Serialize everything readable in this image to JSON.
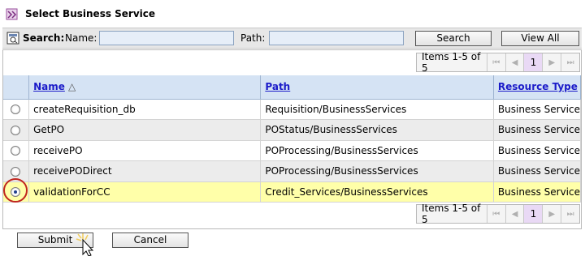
{
  "dialog": {
    "title": "Select Business Service"
  },
  "icons": {
    "title": "business-service-icon",
    "search": "search-icon"
  },
  "search": {
    "label": "Search:",
    "name_label": "Name:",
    "name_value": "",
    "path_label": "Path:",
    "path_value": "",
    "search_button": "Search",
    "view_all_button": "View All"
  },
  "pager": {
    "items_text": "Items 1-5 of 5",
    "current_page": "1",
    "first": "⏮",
    "prev": "◀",
    "next": "▶",
    "last": "⏭"
  },
  "table": {
    "columns": {
      "name": "Name",
      "path": "Path",
      "type": "Resource Type"
    },
    "sort_indicator": "△",
    "rows": [
      {
        "name": "createRequisition_db",
        "path": "Requisition/BusinessServices",
        "type": "Business Service"
      },
      {
        "name": "GetPO",
        "path": "POStatus/BusinessServices",
        "type": "Business Service"
      },
      {
        "name": "receivePO",
        "path": "POProcessing/BusinessServices",
        "type": "Business Service"
      },
      {
        "name": "receivePODirect",
        "path": "POProcessing/BusinessServices",
        "type": "Business Service"
      },
      {
        "name": "validationForCC",
        "path": "Credit_Services/BusinessServices",
        "type": "Business Service"
      }
    ],
    "selected_index": 4
  },
  "footer": {
    "submit": "Submit",
    "cancel": "Cancel"
  },
  "colors": {
    "header_bg": "#d5e3f4",
    "selected_row": "#ffffa9",
    "link": "#1b1bc9",
    "highlight_ring": "#c0261f"
  }
}
